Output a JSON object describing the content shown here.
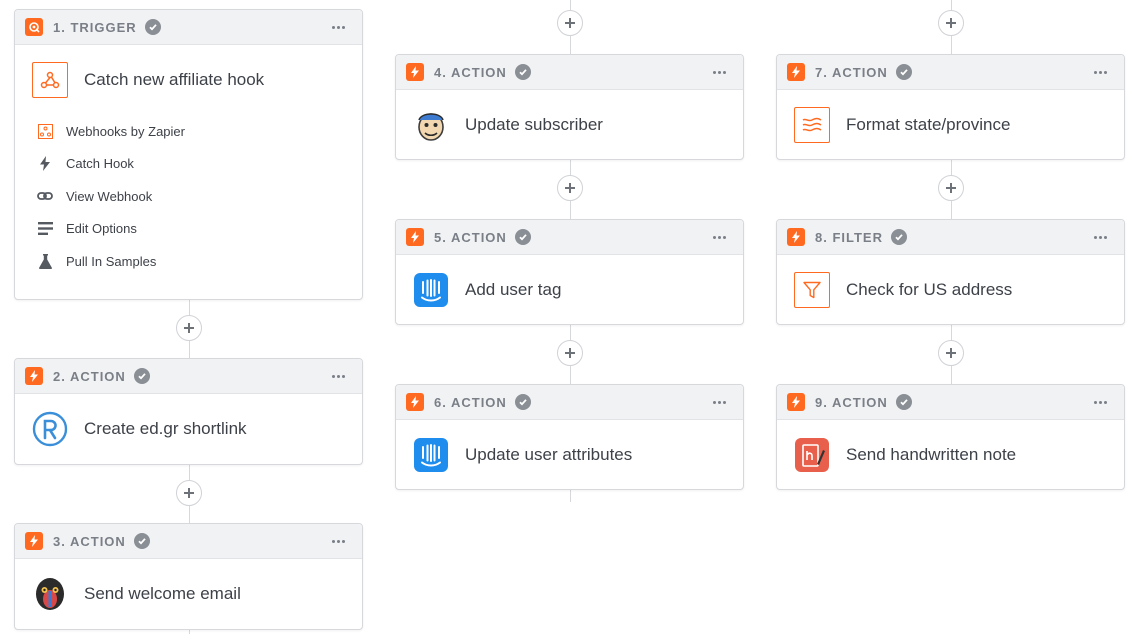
{
  "steps": {
    "s1": {
      "label": "1. TRIGGER",
      "title": "Catch new affiliate hook",
      "icon": "webhook-icon"
    },
    "s2": {
      "label": "2. ACTION",
      "title": "Create ed.gr shortlink",
      "icon": "rebrandly-icon"
    },
    "s3": {
      "label": "3. ACTION",
      "title": "Send welcome email",
      "icon": "mandrill-icon"
    },
    "s4": {
      "label": "4. ACTION",
      "title": "Update subscriber",
      "icon": "mailchimp-icon"
    },
    "s5": {
      "label": "5. ACTION",
      "title": "Add user tag",
      "icon": "intercom-icon"
    },
    "s6": {
      "label": "6. ACTION",
      "title": "Update user attributes",
      "icon": "intercom-icon"
    },
    "s7": {
      "label": "7. ACTION",
      "title": "Format state/province",
      "icon": "formatter-icon"
    },
    "s8": {
      "label": "8. FILTER",
      "title": "Check for US address",
      "icon": "filter-icon"
    },
    "s9": {
      "label": "9. ACTION",
      "title": "Send handwritten note",
      "icon": "handwrytten-icon"
    }
  },
  "trigger_details": [
    {
      "label": "Webhooks by Zapier",
      "icon": "webhook-small-icon"
    },
    {
      "label": "Catch Hook",
      "icon": "bolt-icon"
    },
    {
      "label": "View Webhook",
      "icon": "link-icon"
    },
    {
      "label": "Edit Options",
      "icon": "lines-icon"
    },
    {
      "label": "Pull In Samples",
      "icon": "flask-icon"
    }
  ],
  "colors": {
    "accent": "#ff6a20",
    "header_bg": "#f1f2f4",
    "border": "#d6d8dc",
    "check": "#8a8e95",
    "intercom": "#1f8ded",
    "handwrytten": "#e8604c"
  }
}
